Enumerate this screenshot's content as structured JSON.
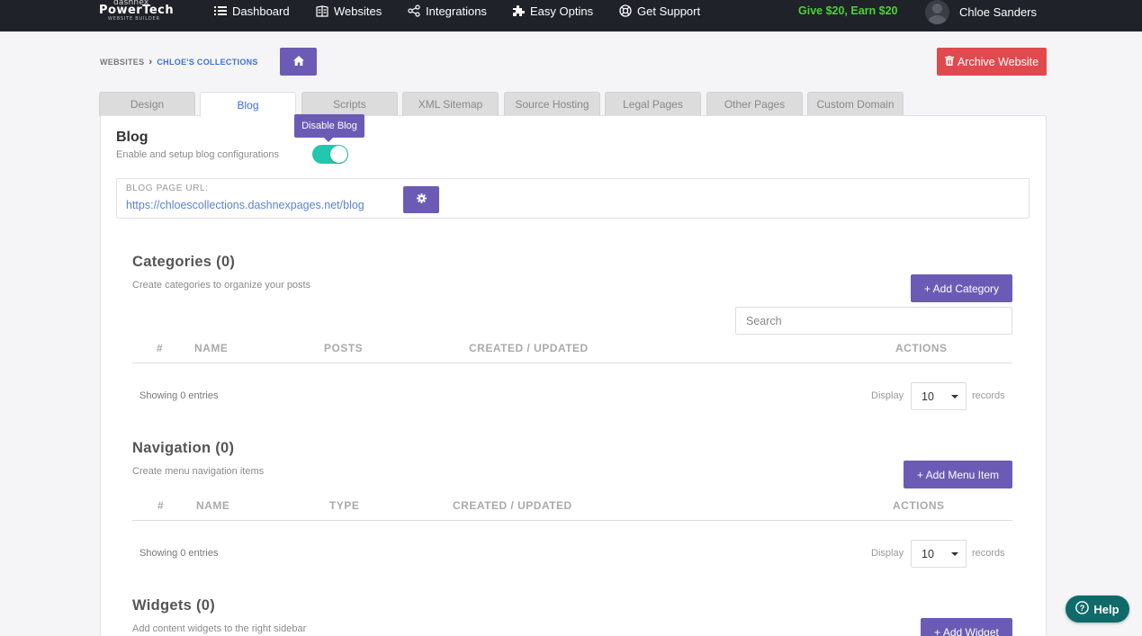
{
  "brand": {
    "line1": "dashnex",
    "line2": "PowerTech",
    "line3": "WEBSITE BUILDER"
  },
  "nav": {
    "items": [
      {
        "label": "Dashboard",
        "icon": "list-icon"
      },
      {
        "label": "Websites",
        "icon": "book-icon"
      },
      {
        "label": "Integrations",
        "icon": "share-icon"
      },
      {
        "label": "Easy Optins",
        "icon": "puzzle-icon"
      },
      {
        "label": "Get Support",
        "icon": "lifebuoy-icon"
      }
    ],
    "promo": "Give $20, Earn $20",
    "user_name": "Chloe Sanders"
  },
  "breadcrumb": {
    "root": "WEBSITES",
    "current": "CHLOE'S COLLECTIONS"
  },
  "archive_label": "Archive Website",
  "tabs": [
    "Design",
    "Blog",
    "Scripts",
    "XML Sitemap",
    "Source Hosting",
    "Legal Pages",
    "Other Pages",
    "Custom Domain"
  ],
  "active_tab": "Blog",
  "blog": {
    "title": "Blog",
    "subtitle": "Enable and setup blog configurations",
    "tooltip": "Disable Blog",
    "enabled": true,
    "url_label": "BLOG PAGE URL:",
    "url": "https://chloescollections.dashnexpages.net/blog"
  },
  "categories": {
    "title": "Categories (0)",
    "subtitle": "Create categories to organize your posts",
    "add_label": "+ Add Category",
    "search_placeholder": "Search",
    "columns": [
      "#",
      "NAME",
      "POSTS",
      "CREATED / UPDATED",
      "ACTIONS"
    ],
    "showing": "Showing 0 entries",
    "display_label": "Display",
    "page_size": "10",
    "records_label": "records"
  },
  "navigation": {
    "title": "Navigation (0)",
    "subtitle": "Create menu navigation items",
    "add_label": "+ Add Menu Item",
    "columns": [
      "#",
      "NAME",
      "TYPE",
      "CREATED / UPDATED",
      "ACTIONS"
    ],
    "showing": "Showing 0 entries",
    "display_label": "Display",
    "page_size": "10",
    "records_label": "records"
  },
  "widgets": {
    "title": "Widgets (0)",
    "subtitle": "Add content widgets to the right sidebar",
    "add_label": "+ Add Widget"
  },
  "help_label": "Help",
  "colors": {
    "accent": "#6c5bb5",
    "danger": "#e04a4f",
    "toggle": "#1ec9b0",
    "promo": "#4cd137",
    "link": "#3b6fd4"
  }
}
